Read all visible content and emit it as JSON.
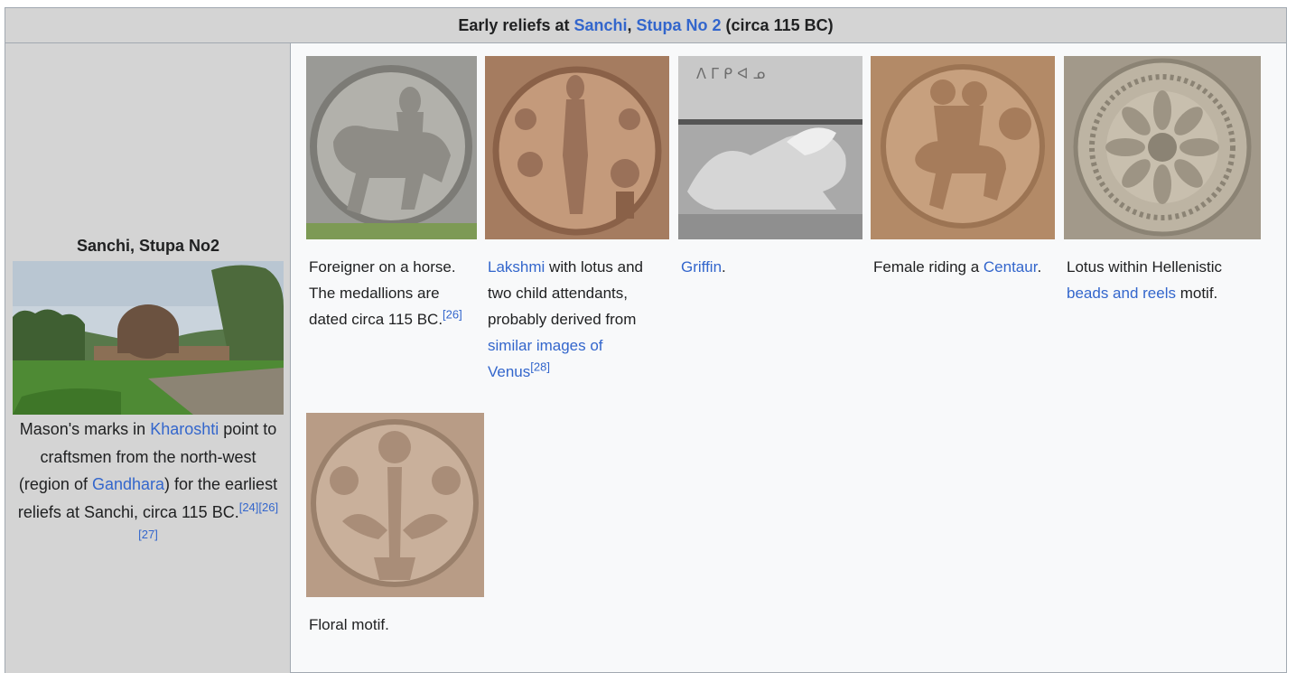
{
  "header": {
    "prefix": "Early reliefs at ",
    "link1": "Sanchi",
    "sep": ", ",
    "link2": "Stupa No 2",
    "suffix": " (circa 115 BC)"
  },
  "sidebar": {
    "title": "Sanchi, Stupa No2",
    "caption_part1": "Mason's marks in ",
    "link_kharoshti": "Kharoshti",
    "caption_part2": " point to craftsmen from the north-west (region of ",
    "link_gandhara": "Gandhara",
    "caption_part3": ") for the earliest reliefs at Sanchi, circa 115 BC.",
    "ref1": "[24]",
    "ref2": "[26]",
    "ref3": "[27]"
  },
  "gallery": {
    "foreigner": {
      "text": "Foreigner on a horse. The medallions are dated circa 115 BC.",
      "ref": "[26]"
    },
    "lakshmi": {
      "link1": "Lakshmi",
      "text": " with lotus and two child attendants, probably derived from ",
      "link2": "similar images of Venus",
      "ref": "[28]"
    },
    "griffin": {
      "link": "Griffin",
      "text": "."
    },
    "centaur": {
      "text": "Female riding a ",
      "link": "Centaur",
      "end": "."
    },
    "lotus": {
      "text": "Lotus within Hellenistic ",
      "link": "beads and reels",
      "end": " motif."
    },
    "floral": {
      "text": "Floral motif."
    }
  }
}
